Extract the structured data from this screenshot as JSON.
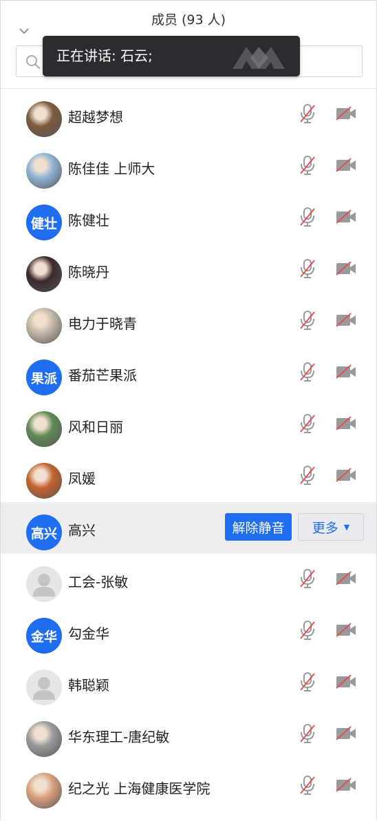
{
  "header": {
    "title": "成员 (93 人)"
  },
  "search": {
    "placeholder": "",
    "value": ""
  },
  "toast": {
    "text": "正在讲话: 石云;"
  },
  "members": [
    {
      "name": "超越梦想",
      "avatar": "photo",
      "muted": true,
      "video_off": true
    },
    {
      "name": "陈佳佳 上师大",
      "avatar": "photo",
      "muted": true,
      "video_off": true
    },
    {
      "name": "陈健壮",
      "avatar": "text",
      "avatar_text": "健壮",
      "muted": true,
      "video_off": true
    },
    {
      "name": "陈晓丹",
      "avatar": "photo",
      "muted": true,
      "video_off": true
    },
    {
      "name": "电力于晓青",
      "avatar": "photo",
      "muted": true,
      "video_off": true
    },
    {
      "name": "番茄芒果派",
      "avatar": "text",
      "avatar_text": "果派",
      "muted": true,
      "video_off": true
    },
    {
      "name": "风和日丽",
      "avatar": "photo",
      "muted": true,
      "video_off": true
    },
    {
      "name": "凤媛",
      "avatar": "photo",
      "muted": true,
      "video_off": true
    },
    {
      "name": "高兴",
      "avatar": "text",
      "avatar_text": "高兴",
      "hovered": true,
      "unmute_label": "解除静音",
      "more_label": "更多"
    },
    {
      "name": "工会-张敏",
      "avatar": "placeholder",
      "muted": true,
      "video_off": true
    },
    {
      "name": "勾金华",
      "avatar": "text",
      "avatar_text": "金华",
      "muted": true,
      "video_off": true
    },
    {
      "name": "韩聪颖",
      "avatar": "placeholder",
      "muted": true,
      "video_off": true
    },
    {
      "name": "华东理工-唐纪敏",
      "avatar": "photo",
      "muted": true,
      "video_off": true
    },
    {
      "name": "纪之光 上海健康医学院",
      "avatar": "photo",
      "muted": true,
      "video_off": true
    }
  ],
  "colors": {
    "accent": "#1f6ef2",
    "muted_slash": "#e5484d",
    "toast_bg": "#2b2c2f",
    "row_hover": "#ededf0"
  }
}
